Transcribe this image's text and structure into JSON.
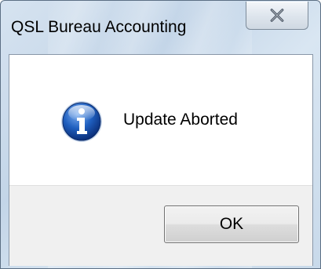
{
  "window": {
    "title": "QSL Bureau Accounting",
    "close_icon": "close-icon"
  },
  "dialog": {
    "icon": "info-icon",
    "icon_color": "#1f5fbf",
    "message": "Update Aborted",
    "ok_label": "OK"
  }
}
